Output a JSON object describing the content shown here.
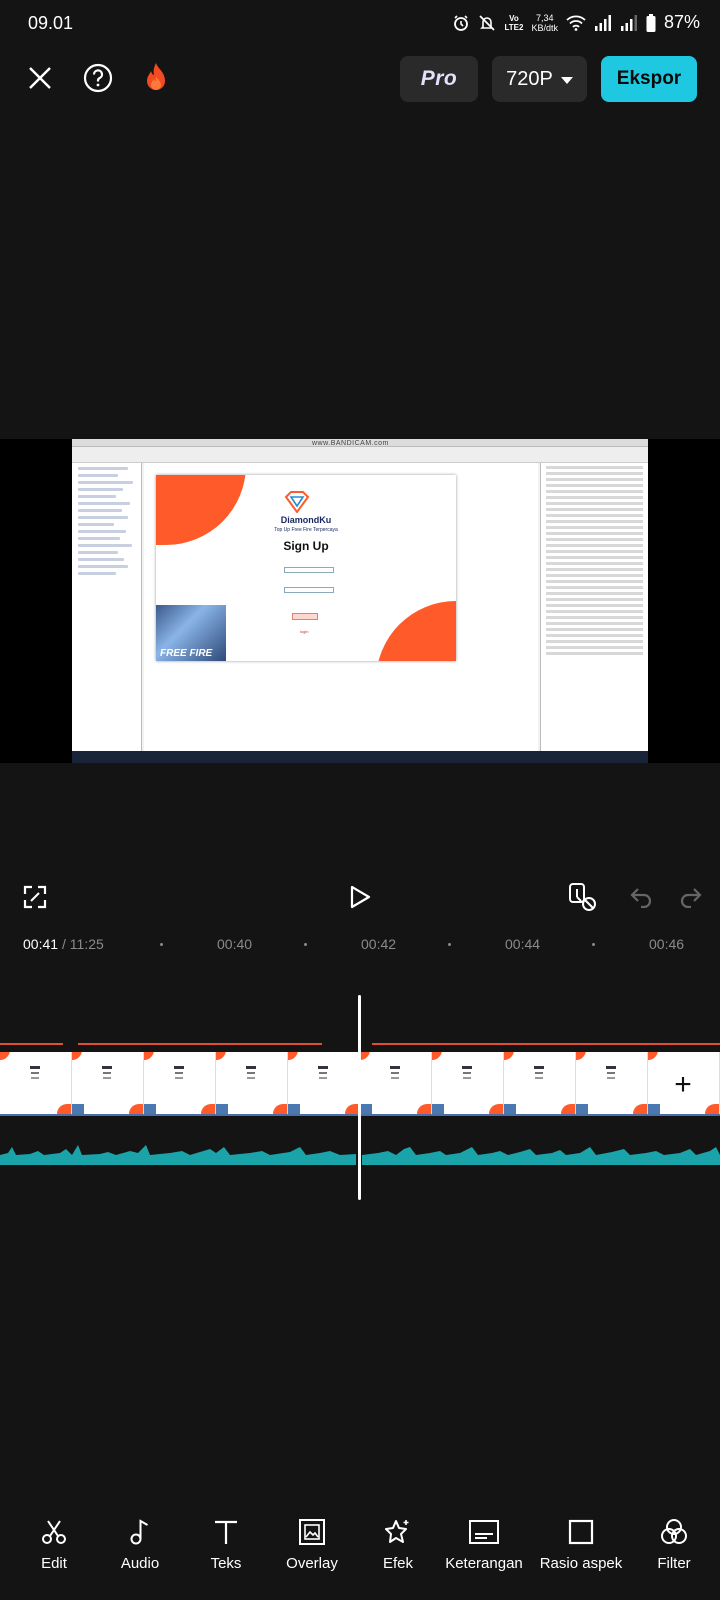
{
  "status_bar": {
    "time": "09.01",
    "network_label": "LTE2",
    "speed_value": "7,34",
    "speed_unit": "KB/dtk",
    "battery": "87%",
    "icons": [
      "alarm-icon",
      "mute-icon",
      "volte-icon",
      "wifi-icon",
      "signal-icon",
      "signal-icon",
      "battery-icon"
    ]
  },
  "toolbar": {
    "close_icon": "close-icon",
    "help_icon": "help-icon",
    "flame_icon": "flame-icon",
    "pro_label": "Pro",
    "resolution_label": "720P",
    "export_label": "Ekspor",
    "accent_color": "#1ec8e0"
  },
  "preview": {
    "app_brand": "DiamondKu",
    "app_tagline": "Top Up Free Fire Terpercaya",
    "signup_title": "Sign Up",
    "signup_button": "Sign Up",
    "login_link": "login",
    "game_text": "FREE FIRE",
    "watermark": "www.BANDICAM.com"
  },
  "controls": {
    "fullscreen_icon": "fullscreen-icon",
    "play_icon": "play-icon",
    "keyframe_icon": "keyframe-off-icon",
    "undo_icon": "undo-icon",
    "redo_icon": "redo-icon"
  },
  "timeline": {
    "current_time": "00:41",
    "total_time": "/ 11:25",
    "ticks": [
      "00:40",
      "00:42",
      "00:44",
      "00:46"
    ],
    "add_clip_label": "+"
  },
  "bottom_nav": {
    "items": [
      {
        "label": "Edit",
        "icon": "scissors-icon"
      },
      {
        "label": "Audio",
        "icon": "music-note-icon"
      },
      {
        "label": "Teks",
        "icon": "text-icon"
      },
      {
        "label": "Overlay",
        "icon": "overlay-icon"
      },
      {
        "label": "Efek",
        "icon": "effects-star-icon"
      },
      {
        "label": "Keterangan",
        "icon": "captions-icon"
      },
      {
        "label": "Rasio aspek",
        "icon": "aspect-ratio-icon"
      },
      {
        "label": "Filter",
        "icon": "filter-icon"
      }
    ]
  }
}
